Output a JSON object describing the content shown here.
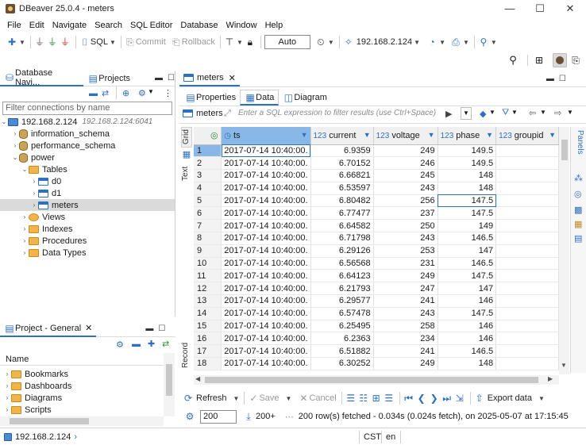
{
  "window": {
    "title": "DBeaver 25.0.4 - meters",
    "minimize": "—",
    "maximize": "☐",
    "close": "✕"
  },
  "menu": [
    "File",
    "Edit",
    "Navigate",
    "Search",
    "SQL Editor",
    "Database",
    "Window",
    "Help"
  ],
  "toolbar": {
    "sql_label": "SQL",
    "commit_label": "Commit",
    "rollback_label": "Rollback",
    "tx_mode": "Auto",
    "connection": "192.168.2.124"
  },
  "left_tabs": {
    "navigator": "Database Navi...",
    "projects": "Projects"
  },
  "filter": {
    "placeholder": "Filter connections by name"
  },
  "tree": {
    "connection": "192.168.2.124",
    "connection_sub": "192.168.2.124:6041",
    "items": [
      {
        "label": "information_schema"
      },
      {
        "label": "performance_schema"
      },
      {
        "label": "power"
      },
      {
        "label": "Tables"
      },
      {
        "label": "d0"
      },
      {
        "label": "d1"
      },
      {
        "label": "meters"
      },
      {
        "label": "Views"
      },
      {
        "label": "Indexes"
      },
      {
        "label": "Procedures"
      },
      {
        "label": "Data Types"
      }
    ]
  },
  "project_panel": {
    "tab": "Project - General",
    "header": "Name",
    "items": [
      {
        "label": "Bookmarks"
      },
      {
        "label": "Dashboards"
      },
      {
        "label": "Diagrams"
      },
      {
        "label": "Scripts"
      }
    ]
  },
  "editor": {
    "tab": "meters",
    "subtabs": {
      "properties": "Properties",
      "data": "Data",
      "diagram": "Diagram"
    },
    "filter_table": "meters",
    "filter_placeholder": "Enter a SQL expression to filter results (use Ctrl+Space)",
    "vtabs": {
      "grid": "Grid",
      "text": "Text",
      "record": "Record"
    },
    "panels_label": "Panels"
  },
  "grid": {
    "columns": [
      {
        "type": "",
        "name": "ts"
      },
      {
        "type": "123",
        "name": "current"
      },
      {
        "type": "123",
        "name": "voltage"
      },
      {
        "type": "123",
        "name": "phase"
      },
      {
        "type": "123",
        "name": "groupid"
      }
    ],
    "rows": [
      {
        "n": "1",
        "ts": "2017-07-14 10:40:00.",
        "current": "6.9359",
        "voltage": "249",
        "phase": "149.5",
        "groupid": ""
      },
      {
        "n": "2",
        "ts": "2017-07-14 10:40:00.",
        "current": "6.70152",
        "voltage": "246",
        "phase": "149.5",
        "groupid": ""
      },
      {
        "n": "3",
        "ts": "2017-07-14 10:40:00.",
        "current": "6.66821",
        "voltage": "245",
        "phase": "148",
        "groupid": ""
      },
      {
        "n": "4",
        "ts": "2017-07-14 10:40:00.",
        "current": "6.53597",
        "voltage": "243",
        "phase": "148",
        "groupid": ""
      },
      {
        "n": "5",
        "ts": "2017-07-14 10:40:00.",
        "current": "6.80482",
        "voltage": "256",
        "phase": "147.5",
        "groupid": ""
      },
      {
        "n": "6",
        "ts": "2017-07-14 10:40:00.",
        "current": "6.77477",
        "voltage": "237",
        "phase": "147.5",
        "groupid": ""
      },
      {
        "n": "7",
        "ts": "2017-07-14 10:40:00.",
        "current": "6.64582",
        "voltage": "250",
        "phase": "149",
        "groupid": ""
      },
      {
        "n": "8",
        "ts": "2017-07-14 10:40:00.",
        "current": "6.71798",
        "voltage": "243",
        "phase": "146.5",
        "groupid": ""
      },
      {
        "n": "9",
        "ts": "2017-07-14 10:40:00.",
        "current": "6.29126",
        "voltage": "253",
        "phase": "147",
        "groupid": ""
      },
      {
        "n": "10",
        "ts": "2017-07-14 10:40:00.",
        "current": "6.56568",
        "voltage": "231",
        "phase": "146.5",
        "groupid": ""
      },
      {
        "n": "11",
        "ts": "2017-07-14 10:40:00.",
        "current": "6.64123",
        "voltage": "249",
        "phase": "147.5",
        "groupid": ""
      },
      {
        "n": "12",
        "ts": "2017-07-14 10:40:00.",
        "current": "6.21793",
        "voltage": "247",
        "phase": "147",
        "groupid": ""
      },
      {
        "n": "13",
        "ts": "2017-07-14 10:40:00.",
        "current": "6.29577",
        "voltage": "241",
        "phase": "146",
        "groupid": ""
      },
      {
        "n": "14",
        "ts": "2017-07-14 10:40:00.",
        "current": "6.57478",
        "voltage": "243",
        "phase": "147.5",
        "groupid": ""
      },
      {
        "n": "15",
        "ts": "2017-07-14 10:40:00.",
        "current": "6.25495",
        "voltage": "258",
        "phase": "146",
        "groupid": ""
      },
      {
        "n": "16",
        "ts": "2017-07-14 10:40:00.",
        "current": "6.2363",
        "voltage": "234",
        "phase": "146",
        "groupid": ""
      },
      {
        "n": "17",
        "ts": "2017-07-14 10:40:00.",
        "current": "6.51882",
        "voltage": "241",
        "phase": "146.5",
        "groupid": ""
      },
      {
        "n": "18",
        "ts": "2017-07-14 10:40:00.",
        "current": "6.30252",
        "voltage": "249",
        "phase": "148",
        "groupid": ""
      }
    ]
  },
  "bottom_toolbar": {
    "refresh": "Refresh",
    "save": "Save",
    "cancel": "Cancel",
    "export": "Export data",
    "fetch_size": "200",
    "fetch_more": "200+",
    "status": "200 row(s) fetched - 0.034s (0.024s fetch), on 2025-05-07 at 17:15:45"
  },
  "statusbar": {
    "connection": "192.168.2.124",
    "tz": "CST",
    "locale": "en"
  },
  "colors": {
    "accent": "#2f6fbf",
    "selected_header": "#8ab8e6",
    "folder": "#f0b44a"
  }
}
